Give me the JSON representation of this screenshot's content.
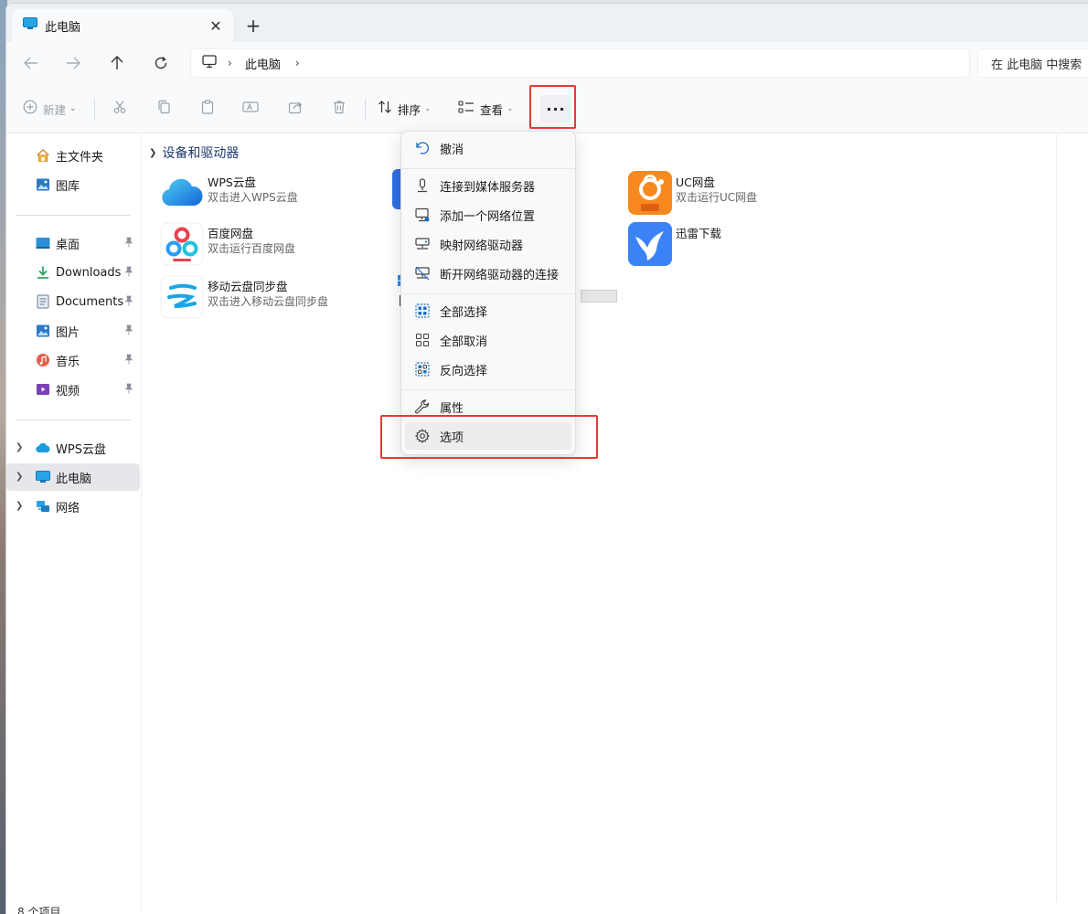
{
  "window": {
    "tab_title": "此电脑",
    "tab_close": "✕",
    "new_tab": "+"
  },
  "address": {
    "crumb": "此电脑",
    "sep1": "›",
    "sep2": "›",
    "search_placeholder": "在 此电脑 中搜索"
  },
  "toolbar": {
    "new_label": "新建",
    "sort_label": "排序",
    "view_label": "查看",
    "more_label": "···"
  },
  "sidebar": {
    "quick": [
      {
        "label": "主文件夹"
      },
      {
        "label": "图库"
      }
    ],
    "pinned": [
      {
        "label": "桌面"
      },
      {
        "label": "Downloads"
      },
      {
        "label": "Documents"
      },
      {
        "label": "图片"
      },
      {
        "label": "音乐"
      },
      {
        "label": "视频"
      }
    ],
    "locations": [
      {
        "label": "WPS云盘"
      },
      {
        "label": "此电脑"
      },
      {
        "label": "网络"
      }
    ]
  },
  "content": {
    "section_title": "设备和驱动器",
    "tiles": [
      {
        "name": "WPS云盘",
        "sub": "双击进入WPS云盘"
      },
      {
        "name": "百度网盘",
        "sub": "双击运行百度网盘"
      },
      {
        "name": "移动云盘同步盘",
        "sub": "双击进入移动云盘同步盘"
      },
      {
        "name": "UC网盘",
        "sub": "双击运行UC网盘"
      },
      {
        "name": "迅雷下载",
        "sub": ""
      }
    ]
  },
  "menu": {
    "items": [
      {
        "label": "撤消"
      },
      {
        "label": "连接到媒体服务器"
      },
      {
        "label": "添加一个网络位置"
      },
      {
        "label": "映射网络驱动器"
      },
      {
        "label": "断开网络驱动器的连接"
      },
      {
        "label": "全部选择"
      },
      {
        "label": "全部取消"
      },
      {
        "label": "反向选择"
      },
      {
        "label": "属性"
      },
      {
        "label": "选项"
      }
    ]
  },
  "status": {
    "count": "8 个项目"
  },
  "colors": {
    "accent": "#0067c0",
    "highlight": "#e53935",
    "uc_orange": "#f7891f",
    "xunlei_blue": "#3b82f6"
  }
}
